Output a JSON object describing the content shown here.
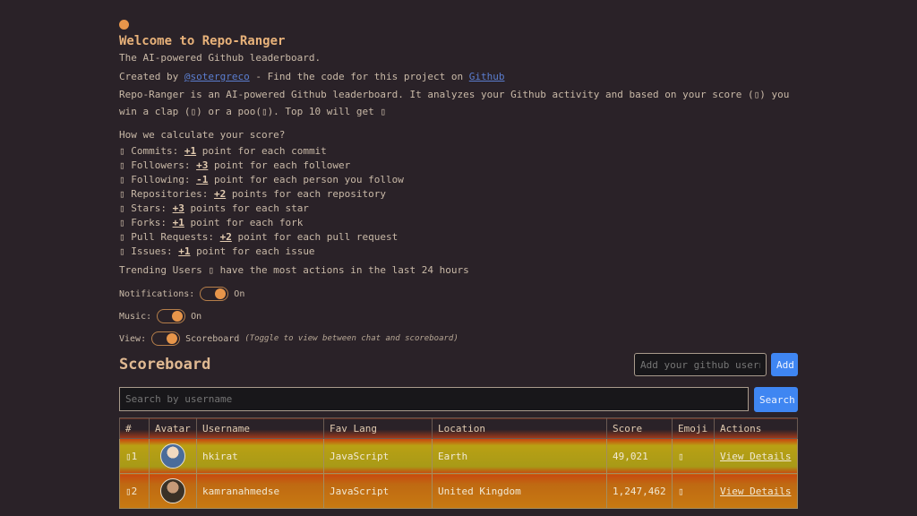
{
  "header": {
    "title": "Welcome to Repo-Ranger",
    "subtitle": "The AI-powered Github leaderboard.",
    "created_by_prefix": "Created by ",
    "author_link": "@sotergreco",
    "created_by_middle": " - Find the code for this project on ",
    "github_link": "Github",
    "description": "Repo-Ranger is an AI-powered Github leaderboard. It analyzes your Github activity and based on your score (▯) you win a clap (▯) or a poo(▯). Top 10 will get ▯"
  },
  "scoring": {
    "question": "How we calculate your score?",
    "rules": [
      {
        "icon": "▯",
        "name": "Commits: ",
        "points": "+1",
        "desc": " point for each commit"
      },
      {
        "icon": "▯",
        "name": "Followers: ",
        "points": "+3",
        "desc": " point for each follower"
      },
      {
        "icon": "▯",
        "name": "Following: ",
        "points": "-1",
        "desc": " point for each person you follow"
      },
      {
        "icon": "▯",
        "name": "Repositories: ",
        "points": "+2",
        "desc": " points for each repository"
      },
      {
        "icon": "▯",
        "name": "Stars: ",
        "points": "+3",
        "desc": " points for each star"
      },
      {
        "icon": "▯",
        "name": "Forks: ",
        "points": "+1",
        "desc": " point for each fork"
      },
      {
        "icon": "▯",
        "name": "Pull Requests: ",
        "points": "+2",
        "desc": " point for each pull request"
      },
      {
        "icon": "▯",
        "name": "Issues: ",
        "points": "+1",
        "desc": " point for each issue"
      }
    ],
    "trending": "Trending Users ▯ have the most actions in the last 24 hours"
  },
  "settings": {
    "notifications_label": "Notifications:",
    "notifications_state": "On",
    "music_label": "Music:",
    "music_state": "On",
    "view_label": "View:",
    "view_state": "Scoreboard",
    "view_hint": "(Toggle to view between chat and scoreboard)"
  },
  "scoreboard": {
    "title": "Scoreboard",
    "add_placeholder": "Add your github username",
    "add_button": "Add",
    "search_placeholder": "Search by username",
    "search_button": "Search",
    "columns": [
      "#",
      "Avatar",
      "Username",
      "Fav Lang",
      "Location",
      "Score",
      "Emoji",
      "Actions"
    ],
    "rows": [
      {
        "rank": "▯1",
        "username": "hkirat",
        "lang": "JavaScript",
        "location": "Earth",
        "score": "49,021",
        "emoji": "▯",
        "action": "View Details"
      },
      {
        "rank": "▯2",
        "username": "kamranahmedse",
        "lang": "JavaScript",
        "location": "United Kingdom",
        "score": "1,247,462",
        "emoji": "▯",
        "action": "View Details"
      }
    ]
  },
  "colors": {
    "accent": "#e7954a",
    "button": "#3f86f2",
    "background": "#2a2228"
  }
}
